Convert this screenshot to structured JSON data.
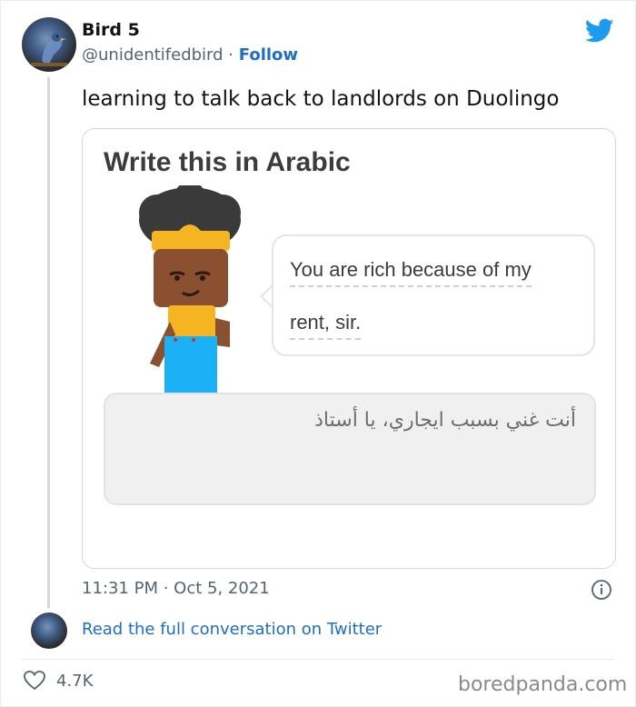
{
  "tweet": {
    "display_name": "Bird 5",
    "handle": "@unidentifedbird",
    "separator": "·",
    "follow_label": "Follow",
    "text": "learning to talk back to landlords on Duolingo",
    "timestamp": "11:31 PM · Oct 5, 2021",
    "read_full_label": "Read the full conversation on Twitter",
    "like_count": "4.7K"
  },
  "media": {
    "instruction": "Write this in Arabic",
    "bubble_line1": "You are rich because of my",
    "bubble_line2": "rent, sir.",
    "answer_text": "أنت غني بسبب ايجاري، يا أستاذ"
  },
  "watermark": "boredpanda.com",
  "colors": {
    "twitter_blue": "#1d9bf0",
    "link_blue": "#1d6fc4",
    "muted_text": "#536471"
  },
  "icons": {
    "logo": "twitter-bird-icon",
    "info": "info-icon",
    "like": "heart-icon"
  }
}
